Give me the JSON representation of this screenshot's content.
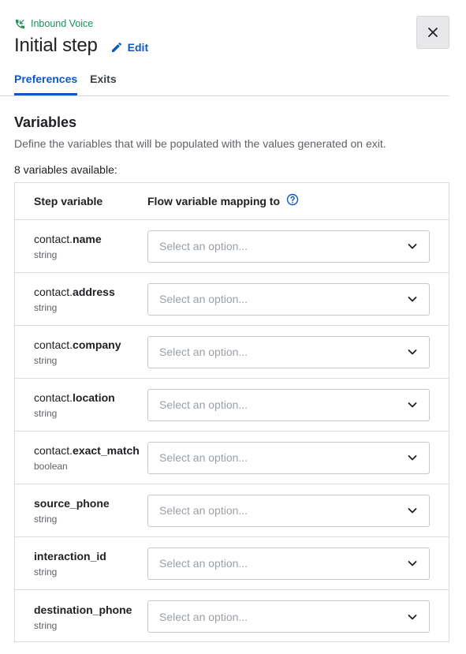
{
  "header": {
    "kicker": "Inbound Voice",
    "title": "Initial step",
    "edit_label": "Edit"
  },
  "tabs": [
    {
      "label": "Preferences",
      "active": true
    },
    {
      "label": "Exits",
      "active": false
    }
  ],
  "section": {
    "title": "Variables",
    "description": "Define the variables that will be populated with the values generated on exit.",
    "count": "8 variables available:"
  },
  "table": {
    "col_step": "Step variable",
    "col_flow": "Flow variable mapping to",
    "select_placeholder": "Select an option...",
    "rows": [
      {
        "prefix": "contact.",
        "name": "name",
        "type": "string"
      },
      {
        "prefix": "contact.",
        "name": "address",
        "type": "string"
      },
      {
        "prefix": "contact.",
        "name": "company",
        "type": "string"
      },
      {
        "prefix": "contact.",
        "name": "location",
        "type": "string"
      },
      {
        "prefix": "contact.",
        "name": "exact_match",
        "type": "boolean"
      },
      {
        "prefix": "",
        "name": "source_phone",
        "type": "string"
      },
      {
        "prefix": "",
        "name": "interaction_id",
        "type": "string"
      },
      {
        "prefix": "",
        "name": "destination_phone",
        "type": "string"
      }
    ]
  },
  "colors": {
    "brand_green": "#1e8e5a",
    "accent_blue": "#0a59c4",
    "border": "#dadce0"
  },
  "icons": {
    "kicker": "phone-incoming-icon",
    "edit": "pencil-icon",
    "close": "close-icon",
    "help": "help-circle-icon",
    "select": "chevron-down-icon"
  }
}
